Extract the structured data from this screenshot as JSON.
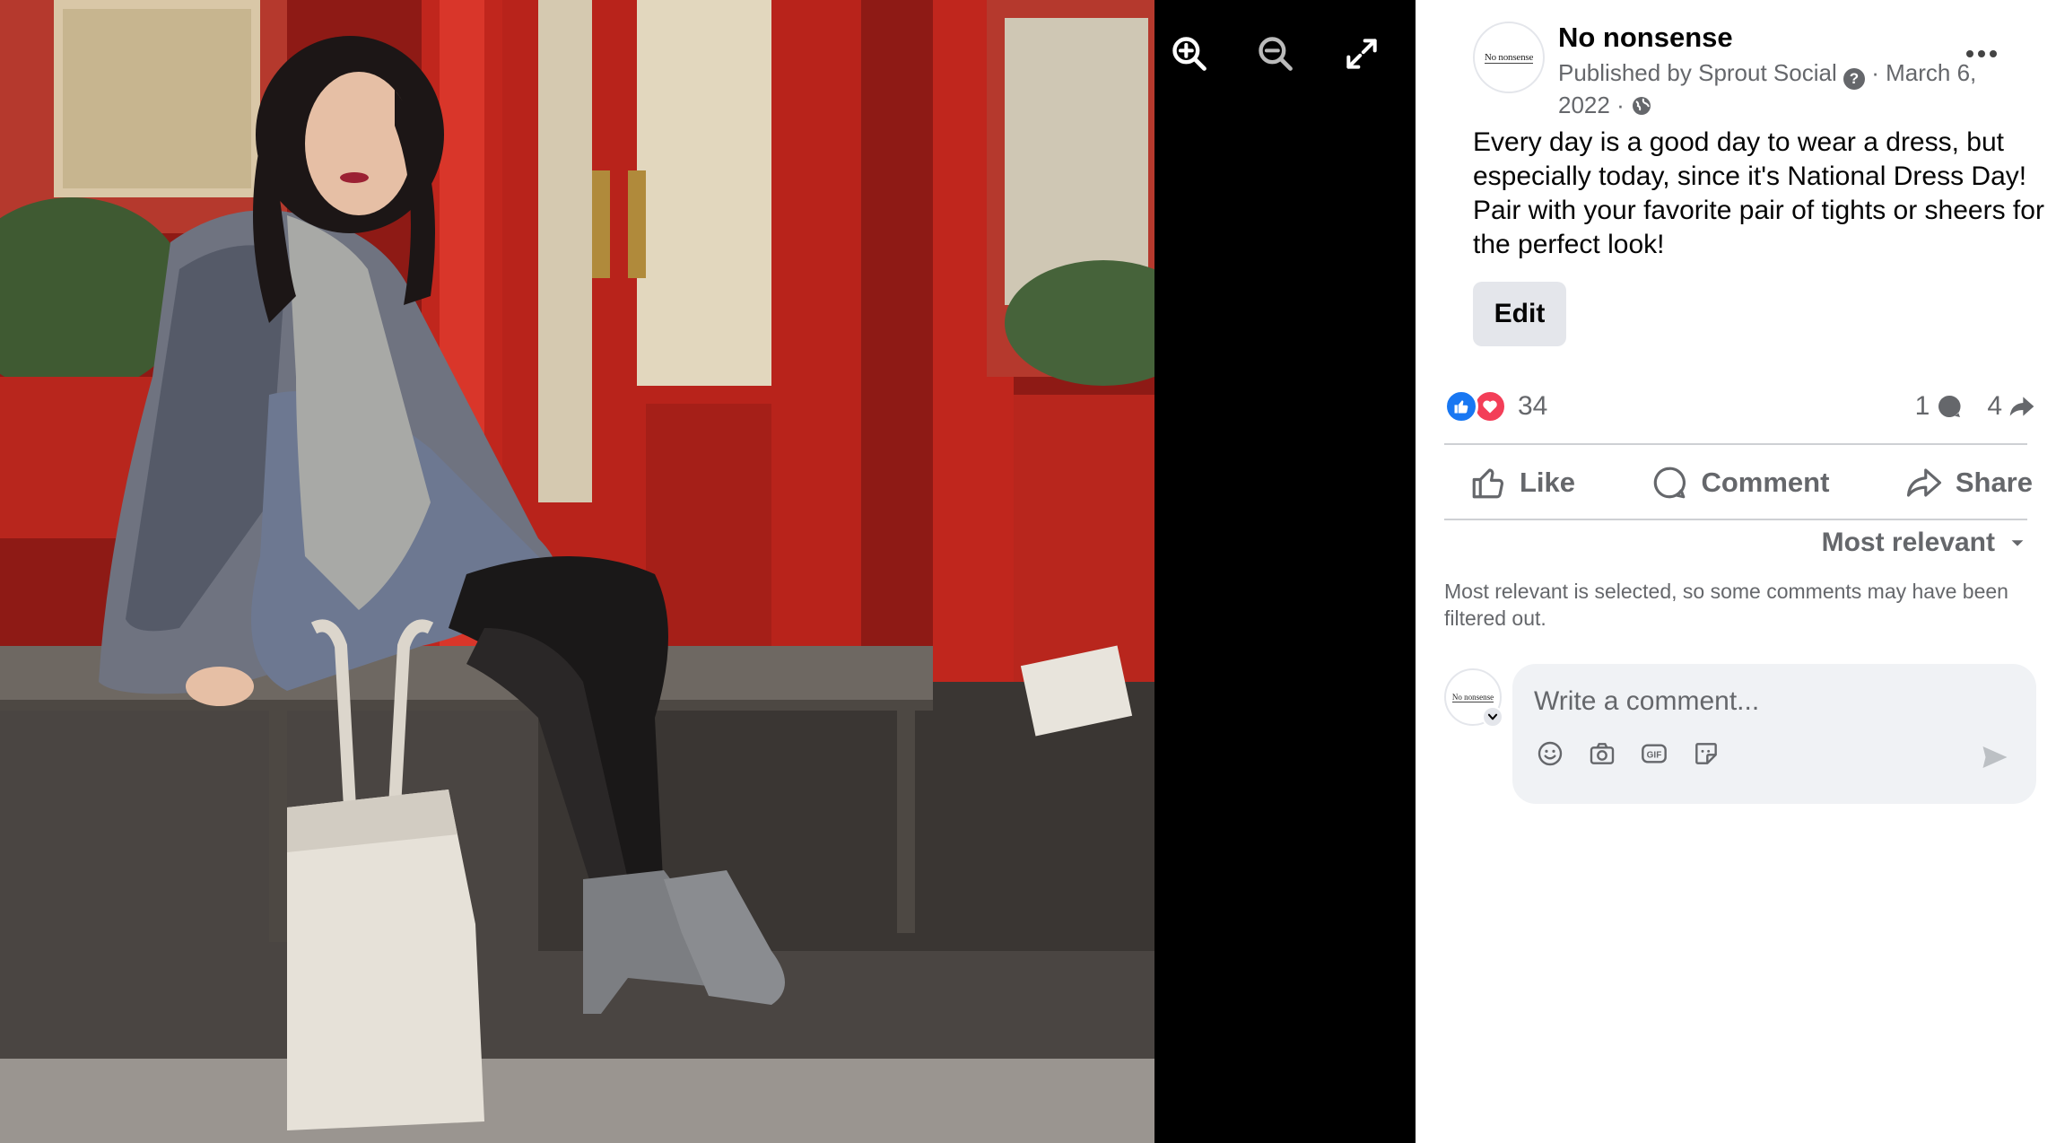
{
  "viewer": {
    "zoom_in_icon": "zoom-in-icon",
    "zoom_out_icon": "zoom-out-icon",
    "fullscreen_icon": "expand-icon"
  },
  "post": {
    "page_name": "No nonsense",
    "avatar_text": "No nonsense",
    "published_by": "Published by Sprout Social",
    "date": "March 6, 2022",
    "text": "Every day is a good day to wear a dress, but especially today, since it's National Dress Day! Pair with your favorite pair of tights or sheers for the perfect look!",
    "edit_label": "Edit",
    "reaction_count": "34",
    "comment_count": "1",
    "share_count": "4",
    "actions": {
      "like": "Like",
      "comment": "Comment",
      "share": "Share"
    },
    "sort_label": "Most relevant",
    "filter_note": "Most relevant is selected, so some comments may have been filtered out.",
    "comment_placeholder": "Write a comment...",
    "composer_tools": [
      "emoji-icon",
      "camera-icon",
      "gif-icon",
      "sticker-icon"
    ]
  },
  "colors": {
    "accent": "#1877f2",
    "love": "#f33e58",
    "secondary_text": "#65676b",
    "primary_text": "#050505",
    "button_bg": "#e4e6eb",
    "composer_bg": "#f0f2f5"
  }
}
